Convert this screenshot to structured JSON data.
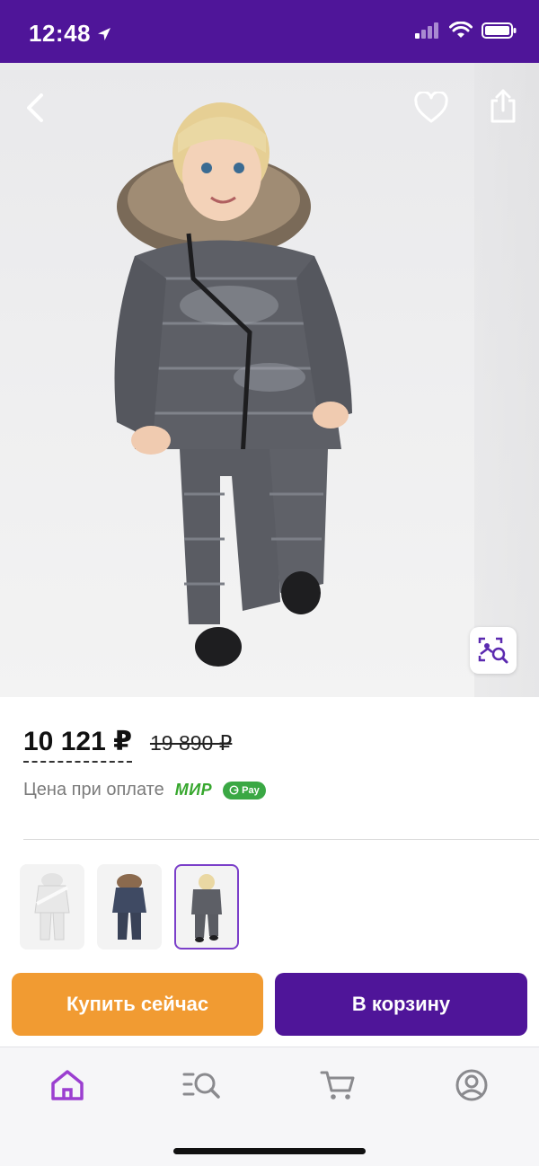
{
  "status_bar": {
    "time": "12:48",
    "background": "#4f1599"
  },
  "product": {
    "price_current": "10 121 ₽",
    "price_old": "19 890 ₽",
    "payment_label": "Цена при оплате",
    "mir_logo": "МИР",
    "gpay_label": "Pay"
  },
  "thumbnails": [
    {
      "color": "white",
      "selected": false
    },
    {
      "color": "navy",
      "selected": false
    },
    {
      "color": "gray",
      "selected": true
    }
  ],
  "actions": {
    "buy_now_label": "Купить сейчас",
    "add_to_cart_label": "В корзину",
    "buy_color": "#f19b32",
    "cart_color": "#4f1599"
  },
  "tabbar": {
    "items": [
      {
        "icon": "home-icon",
        "active": true
      },
      {
        "icon": "catalog-search-icon",
        "active": false
      },
      {
        "icon": "cart-icon",
        "active": false
      },
      {
        "icon": "profile-icon",
        "active": false
      }
    ],
    "active_color": "#9b3fd0"
  }
}
